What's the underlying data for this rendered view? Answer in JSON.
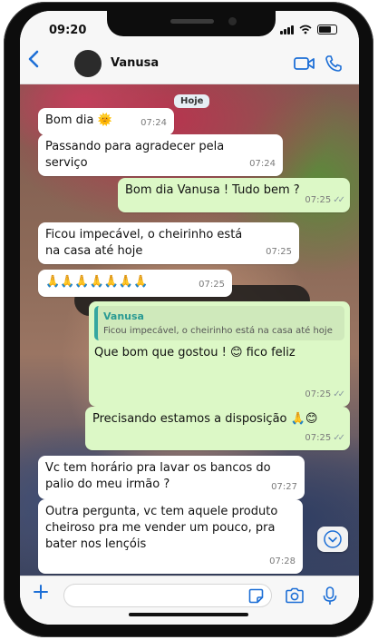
{
  "status_bar": {
    "time": "09:20"
  },
  "header": {
    "contact_name": "Vanusa"
  },
  "chat": {
    "date_label": "Hoje",
    "messages": [
      {
        "dir": "in",
        "text": "Bom dia 🌞",
        "time": "07:24"
      },
      {
        "dir": "in",
        "text": "Passando para agradecer pela serviço",
        "time": "07:24"
      },
      {
        "dir": "out",
        "text": "Bom dia Vanusa ! Tudo bem ?",
        "time": "07:25"
      },
      {
        "dir": "in",
        "text": "Ficou impecável, o cheirinho está na casa até hoje",
        "time": "07:25"
      },
      {
        "dir": "in",
        "text": "🙏🙏🙏🙏🙏🙏🙏",
        "time": "07:25"
      },
      {
        "dir": "out",
        "quote_name": "Vanusa",
        "quote_text": "Ficou impecável, o cheirinho está na casa até hoje",
        "text": "Que bom que gostou ! 😊 fico feliz",
        "time": "07:25"
      },
      {
        "dir": "out",
        "text": "Precisando estamos a disposição 🙏😊",
        "time": "07:25"
      },
      {
        "dir": "in",
        "text": "Vc tem horário pra lavar os bancos do palio do meu irmão ?",
        "time": "07:27"
      },
      {
        "dir": "in",
        "text": "Outra pergunta, vc tem aquele produto cheiroso pra me vender um pouco, pra bater nos lençóis",
        "time": "07:28"
      }
    ]
  },
  "icons": {
    "back": "chevron-left-icon",
    "video": "video-call-icon",
    "phone": "phone-call-icon",
    "scroll_down": "chevron-down-icon",
    "attach": "plus-icon",
    "sticker": "sticker-icon",
    "camera": "camera-icon",
    "mic": "microphone-icon"
  },
  "colors": {
    "accent": "#1d6fd6",
    "outgoing_bubble": "#dcf8c6",
    "incoming_bubble": "#ffffff",
    "quote_accent": "#35a7a0"
  }
}
